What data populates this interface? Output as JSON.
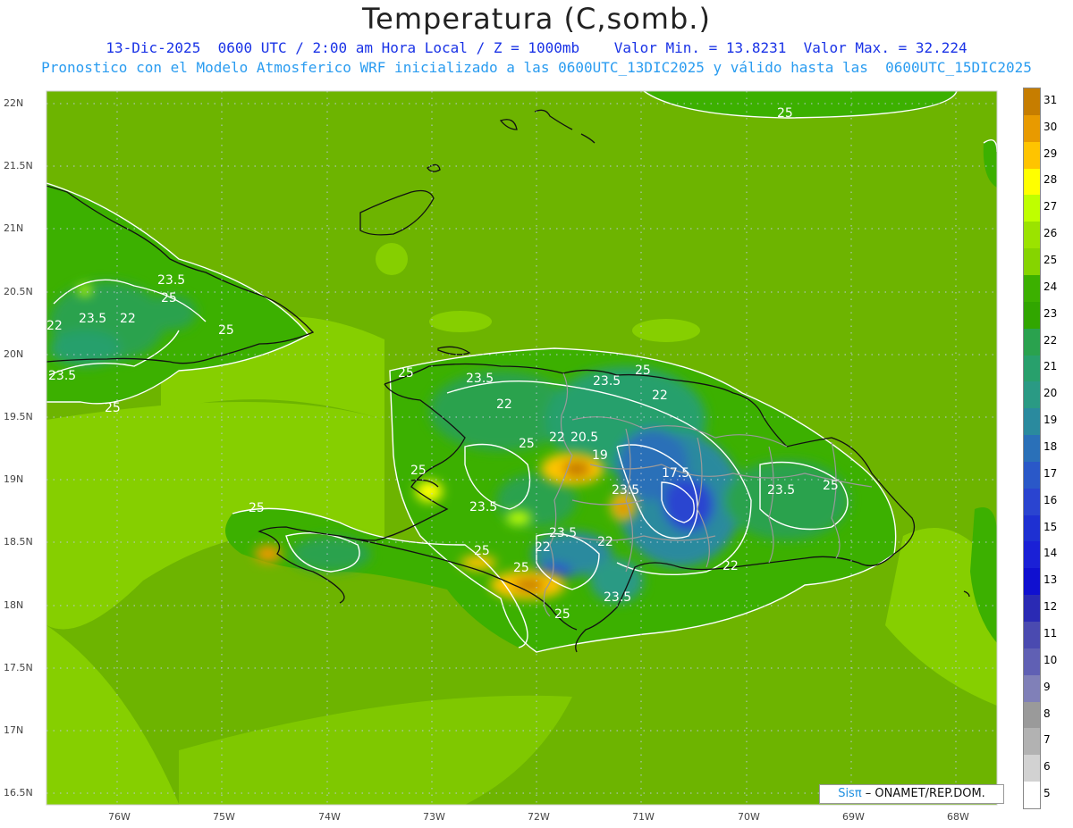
{
  "header": {
    "title": "Temperatura (C,somb.)",
    "line1": "13-Dic-2025  0600 UTC / 2:00 am Hora Local / Z = 1000mb    Valor Min. = 13.8231  Valor Max. = 32.224",
    "line2": "Pronostico con el Modelo Atmosferico WRF inicializado a las 0600UTC_13DIC2025 y válido hasta las  0600UTC_15DIC2025"
  },
  "axes": {
    "lat_labels": [
      "22N",
      "21.5N",
      "21N",
      "20.5N",
      "20N",
      "19.5N",
      "19N",
      "18.5N",
      "18N",
      "17.5N",
      "17N",
      "16.5N"
    ],
    "lon_labels": [
      "76W",
      "75W",
      "74W",
      "73W",
      "72W",
      "71W",
      "70W",
      "69W",
      "68W"
    ]
  },
  "colorbar": {
    "labels": [
      "31",
      "30",
      "29",
      "28",
      "27",
      "26",
      "25",
      "24",
      "23",
      "22",
      "21",
      "20",
      "19",
      "18",
      "17",
      "16",
      "15",
      "14",
      "13",
      "12",
      "11",
      "10",
      "9",
      "8",
      "7",
      "6",
      "5"
    ],
    "colors": [
      "#c67d00",
      "#e89a00",
      "#ffc400",
      "#ffff00",
      "#bfff00",
      "#9be300",
      "#86d400",
      "#3cb000",
      "#31a600",
      "#2aa24e",
      "#28a06c",
      "#2a9a84",
      "#2a8a9e",
      "#2a70b8",
      "#2a58c8",
      "#2a44d0",
      "#1e30d2",
      "#1a20d6",
      "#1010d0",
      "#2a2ab4",
      "#4a4ab0",
      "#6060b4",
      "#8080b8",
      "#9a9a9a",
      "#b2b2b2",
      "#d2d2d2",
      "#ffffff"
    ]
  },
  "contour_labels": [
    "25",
    "23.5",
    "25",
    "22",
    "23.5",
    "22",
    "25",
    "23.5",
    "25",
    "25",
    "23.5",
    "25",
    "22",
    "25",
    "22",
    "20.5",
    "19",
    "17.5",
    "23.5",
    "25",
    "23.5",
    "25",
    "22",
    "25",
    "23.5",
    "22",
    "23.5",
    "25",
    "22",
    "23.5",
    "22",
    "25",
    "25",
    "23.5"
  ],
  "credit": {
    "sis": "Sisπ",
    "rest": " – ONAMET/REP.DOM."
  }
}
